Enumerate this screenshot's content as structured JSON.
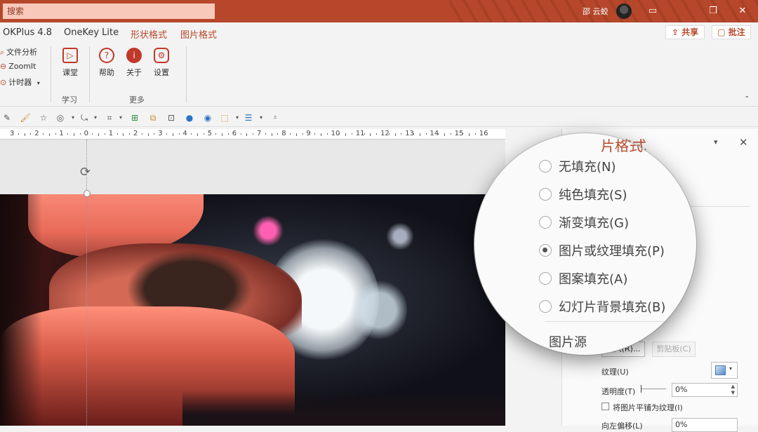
{
  "titlebar": {
    "search_placeholder": "搜索",
    "user_name": "邵 云蛟",
    "ribbon_display_icon": "ribbon-display-icon",
    "restore_icon": "restore-icon",
    "close_icon": "close-icon"
  },
  "menu": {
    "tabs": [
      {
        "label": "OKPlus 4.8"
      },
      {
        "label": "OneKey Lite"
      },
      {
        "label": "形状格式"
      },
      {
        "label": "图片格式"
      }
    ],
    "share_label": "共享",
    "comment_label": "批注"
  },
  "ribbon": {
    "small_items": [
      {
        "label": "文件分析"
      },
      {
        "label": "ZoomIt"
      },
      {
        "label": "计时器"
      }
    ],
    "big_items": [
      {
        "label": "课堂"
      },
      {
        "label": "帮助"
      },
      {
        "label": "关于"
      },
      {
        "label": "设置"
      }
    ],
    "groups": [
      {
        "label": "学习"
      },
      {
        "label": "更多"
      }
    ]
  },
  "ruler": {
    "ticks": [
      "3",
      "2",
      "1",
      "0",
      "1",
      "2",
      "3",
      "4",
      "5",
      "6",
      "7",
      "8",
      "9",
      "10",
      "11",
      "12",
      "13",
      "14",
      "15",
      "16"
    ]
  },
  "panel": {
    "title": "片格式",
    "insert_label": "插入(R)...",
    "clipboard_label": "剪贴板(C)",
    "texture_label": "纹理(U)",
    "transparency_label": "透明度(T)",
    "transparency_value": "0%",
    "tile_label": "将图片平铺为纹理(I)",
    "offset_label": "向左偏移(L)",
    "offset_value": "0%"
  },
  "magnifier": {
    "title": "片格式",
    "options": [
      {
        "label": "无填充(N)",
        "selected": false
      },
      {
        "label": "纯色填充(S)",
        "selected": false
      },
      {
        "label": "渐变填充(G)",
        "selected": false
      },
      {
        "label": "图片或纹理填充(P)",
        "selected": true
      },
      {
        "label": "图案填充(A)",
        "selected": false
      },
      {
        "label": "幻灯片背景填充(B)",
        "selected": false
      }
    ],
    "source_label": "图片源"
  },
  "colors": {
    "accent": "#b7472a",
    "titlebar": "#b7472a",
    "ribbon_bg": "#f3f3f3"
  }
}
